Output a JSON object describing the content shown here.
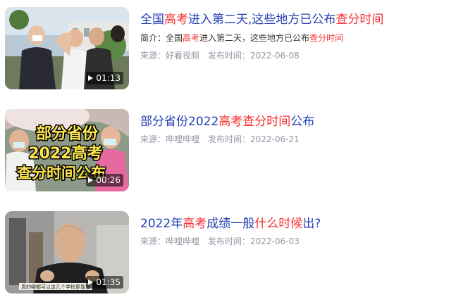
{
  "results": [
    {
      "title_parts": [
        {
          "text": "全国",
          "hl": false
        },
        {
          "text": "高考",
          "hl": true
        },
        {
          "text": "进入第二天,这些地方已公布",
          "hl": false
        },
        {
          "text": "查分时间",
          "hl": true
        }
      ],
      "summary_label": "简介：",
      "summary_parts": [
        {
          "text": "全国",
          "hl": false
        },
        {
          "text": "高考",
          "hl": true
        },
        {
          "text": "进入第二天，这些地方已公布",
          "hl": false
        },
        {
          "text": "查分时间",
          "hl": true
        }
      ],
      "source": "来源：好看视频",
      "date": "发布时间：2022-06-08",
      "duration": "01:13"
    },
    {
      "title_parts": [
        {
          "text": "部分省份2022",
          "hl": false
        },
        {
          "text": "高考查分时间",
          "hl": true
        },
        {
          "text": "公布",
          "hl": false
        }
      ],
      "thumb_caption": [
        "部分省份",
        "2022高考",
        "查分时间公布"
      ],
      "source": "来源：哔哩哔哩",
      "date": "发布时间：2022-06-21",
      "duration": "00:26"
    },
    {
      "title_parts": [
        {
          "text": "2022年",
          "hl": false
        },
        {
          "text": "高考",
          "hl": true
        },
        {
          "text": "成绩一般",
          "hl": false
        },
        {
          "text": "什么时候",
          "hl": true
        },
        {
          "text": "出?",
          "hl": false
        }
      ],
      "thumb_caption": [
        "真的哪都可以这几个学校更靠谱"
      ],
      "source": "来源：哔哩哔哩",
      "date": "发布时间：2022-06-03",
      "duration": "01:35"
    }
  ]
}
